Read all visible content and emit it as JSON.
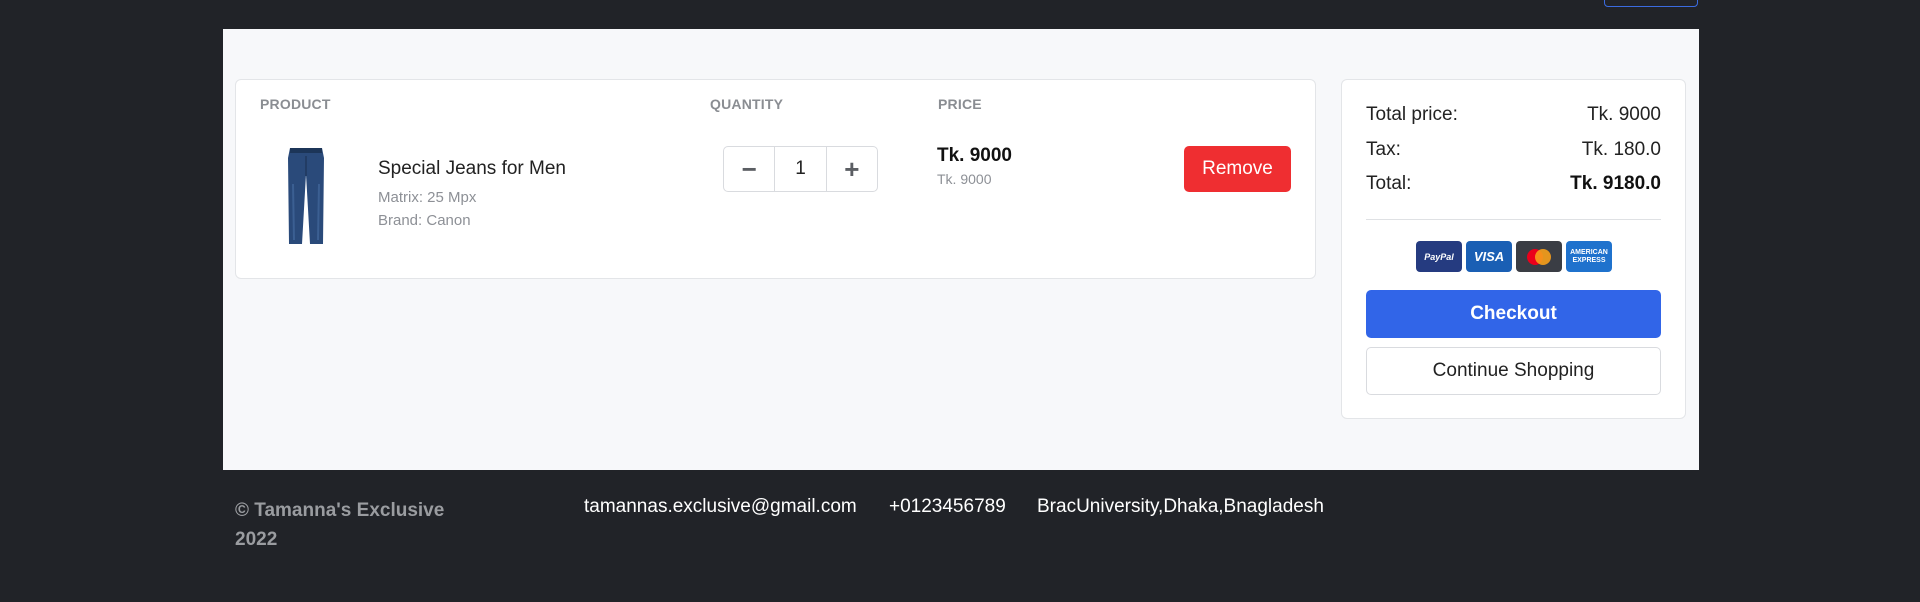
{
  "cart": {
    "headers": {
      "product": "PRODUCT",
      "quantity": "QUANTITY",
      "price": "PRICE"
    },
    "items": [
      {
        "name": "Special Jeans for Men",
        "matrix": "Matrix: 25 Mpx",
        "brand": "Brand: Canon",
        "quantity": "1",
        "price": "Tk. 9000",
        "unit_price": "Tk. 9000",
        "remove_label": "Remove"
      }
    ]
  },
  "summary": {
    "total_price_label": "Total price:",
    "total_price_value": "Tk. 9000",
    "tax_label": "Tax:",
    "tax_value": "Tk. 180.0",
    "total_label": "Total:",
    "total_value": "Tk. 9180.0",
    "payment_icons": [
      "paypal-icon",
      "visa-icon",
      "mastercard-icon",
      "amex-icon"
    ],
    "checkout_label": "Checkout",
    "continue_label": "Continue Shopping"
  },
  "footer": {
    "copyright": "© Tamanna's Exclusive 2022",
    "email": "tamannas.exclusive@gmail.com",
    "phone": "+0123456789",
    "address": "BracUniversity,Dhaka,Bnagladesh"
  },
  "colors": {
    "background": "#212328",
    "primary": "#3165e8",
    "danger": "#ef2e31"
  }
}
